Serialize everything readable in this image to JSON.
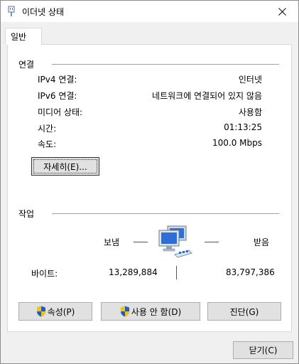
{
  "window": {
    "title": "이더넷 상태",
    "close_glyph": "✕"
  },
  "tab": {
    "label": "일반"
  },
  "connection": {
    "section_title": "연결",
    "rows": [
      {
        "label": "IPv4 연결:",
        "value": "인터넷"
      },
      {
        "label": "IPv6 연결:",
        "value": "네트워크에 연결되어 있지 않음"
      },
      {
        "label": "미디어 상태:",
        "value": "사용함"
      },
      {
        "label": "시간:",
        "value": "01:13:25"
      },
      {
        "label": "속도:",
        "value": "100.0 Mbps"
      }
    ],
    "details_button": "자세히(E)..."
  },
  "activity": {
    "section_title": "작업",
    "sent_label": "보냄",
    "received_label": "받음",
    "bytes_label": "바이트:",
    "bytes_sent": "13,289,884",
    "bytes_received": "83,797,386",
    "network_icon": "network-computers-icon"
  },
  "actions": {
    "properties": "속성(P)",
    "disable": "사용 안 함(D)",
    "diagnose": "진단(G)"
  },
  "footer": {
    "close": "닫기(C)"
  },
  "colors": {
    "shield_blue": "#1f5fbf",
    "shield_yellow": "#f2c21b",
    "monitor_blue": "#2d6fd6"
  }
}
